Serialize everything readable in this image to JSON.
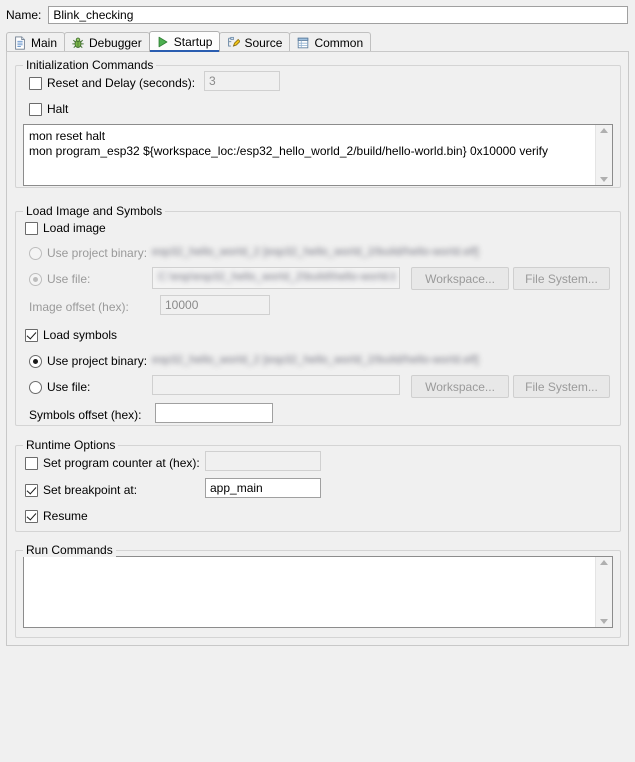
{
  "window": {
    "name_label": "Name:",
    "name_value": "Blink_checking"
  },
  "tabs": [
    {
      "label": "Main",
      "icon": "document-icon",
      "active": false
    },
    {
      "label": "Debugger",
      "icon": "bug-icon",
      "active": false
    },
    {
      "label": "Startup",
      "icon": "run-play-icon",
      "active": true
    },
    {
      "label": "Source",
      "icon": "source-edit-icon",
      "active": false
    },
    {
      "label": "Common",
      "icon": "table-icon",
      "active": false
    }
  ],
  "initialization_commands": {
    "legend": "Initialization Commands",
    "reset_and_delay_label": "Reset and Delay (seconds):",
    "reset_and_delay_checked": false,
    "reset_delay_value": "3",
    "halt_label": "Halt",
    "halt_checked": false,
    "commands_text": "mon reset halt\nmon program_esp32 ${workspace_loc:/esp32_hello_world_2/build/hello-world.bin} 0x10000 verify"
  },
  "load_image_and_symbols": {
    "legend": "Load Image and Symbols",
    "load_image_label": "Load image",
    "load_image_checked": false,
    "image_use_project_binary_label": "Use project binary:",
    "image_use_project_binary_selected": false,
    "image_project_binary_value": "esp32_hello_world_2 [esp32_hello_world_2/build/hello-world.elf]",
    "image_use_file_label": "Use file:",
    "image_use_file_selected": true,
    "image_file_value": "C:\\esp\\esp32_hello_world_2\\build\\hello-world.bin",
    "image_offset_label": "Image offset (hex):",
    "image_offset_value": "10000",
    "load_symbols_label": "Load symbols",
    "load_symbols_checked": true,
    "symbols_use_project_binary_label": "Use project binary:",
    "symbols_use_project_binary_selected": true,
    "symbols_project_binary_value": "esp32_hello_world_2 [esp32_hello_world_2/build/hello-world.elf]",
    "symbols_use_file_label": "Use file:",
    "symbols_use_file_selected": false,
    "symbols_file_value": "",
    "symbols_offset_label": "Symbols offset (hex):",
    "symbols_offset_value": "",
    "workspace_button_label": "Workspace...",
    "file_system_button_label": "File System..."
  },
  "runtime_options": {
    "legend": "Runtime Options",
    "set_pc_label": "Set program counter at (hex):",
    "set_pc_checked": false,
    "set_pc_value": "",
    "set_breakpoint_label": "Set breakpoint at:",
    "set_breakpoint_checked": true,
    "set_breakpoint_value": "app_main",
    "resume_label": "Resume",
    "resume_checked": true
  },
  "run_commands": {
    "legend": "Run Commands",
    "text": ""
  },
  "colors": {
    "accent": "#2a5db0",
    "panel_bg": "#f0f0f0",
    "field_bg": "#ffffff",
    "disabled_text": "#9a9a9a"
  }
}
